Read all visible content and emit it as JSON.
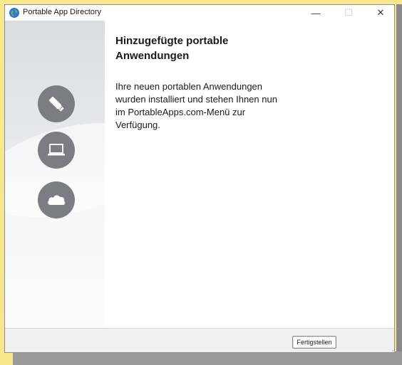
{
  "window": {
    "title": "Portable App Directory",
    "minimize_glyph": "—",
    "maximize_glyph": "☐",
    "close_glyph": "✕"
  },
  "sidebar": {
    "icons": [
      "usb-drive-icon",
      "laptop-icon",
      "cloud-icon"
    ],
    "circle_color": "#7a7e82"
  },
  "content": {
    "heading": "Hinzugefügte portable Anwendungen",
    "body": "Ihre neuen portablen Anwendungen wurden installiert und stehen Ihnen nun im PortableApps.com-Menü zur Verfügung."
  },
  "footer": {
    "finish_label": "Fertigstellen"
  },
  "colors": {
    "desktop": "#f7e98a",
    "window_border": "#8e8e8e",
    "footer_bg": "#f0f0f0"
  }
}
